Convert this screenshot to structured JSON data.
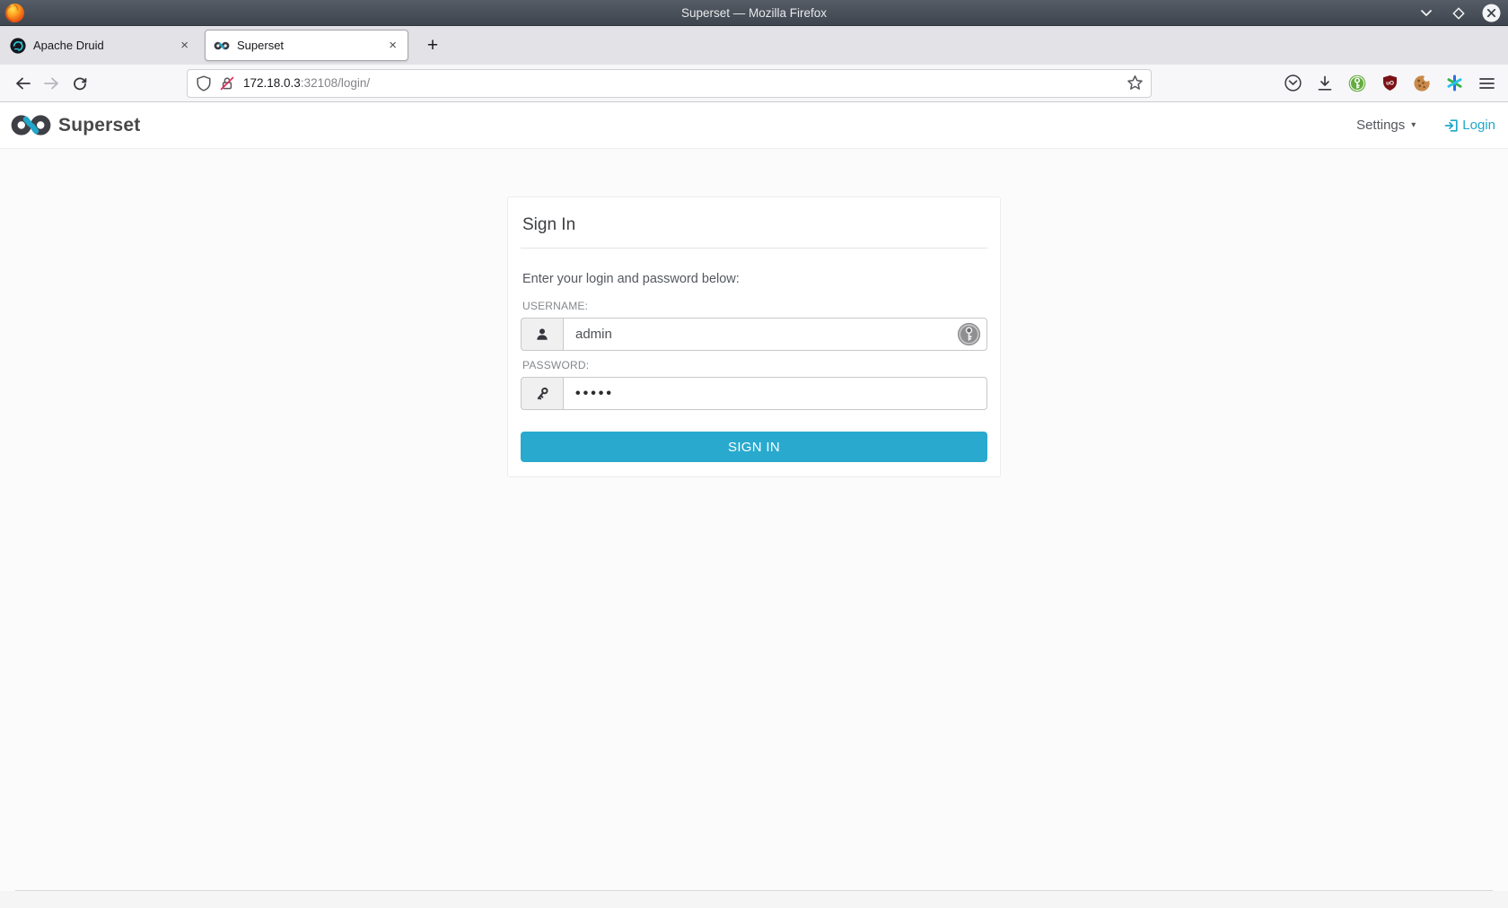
{
  "window": {
    "title": "Superset — Mozilla Firefox"
  },
  "browser": {
    "tabs": [
      {
        "label": "Apache Druid"
      },
      {
        "label": "Superset"
      }
    ],
    "close_tab_glyph": "×",
    "new_tab_glyph": "+",
    "url": {
      "host": "172.18.0.3",
      "path": ":32108/login/"
    }
  },
  "app_navbar": {
    "brand": "Superset",
    "settings_label": "Settings",
    "settings_caret": "▾",
    "login_label": "Login"
  },
  "login_card": {
    "title": "Sign In",
    "instruction": "Enter your login and password below:",
    "username_label": "USERNAME:",
    "username_value": "admin",
    "password_label": "PASSWORD:",
    "password_value": "•••••",
    "submit_label": "SIGN IN"
  },
  "colors": {
    "accent_blue": "#20a7c9",
    "button_cyan": "#29a9ce",
    "titlebar_dark": "#464d56"
  }
}
